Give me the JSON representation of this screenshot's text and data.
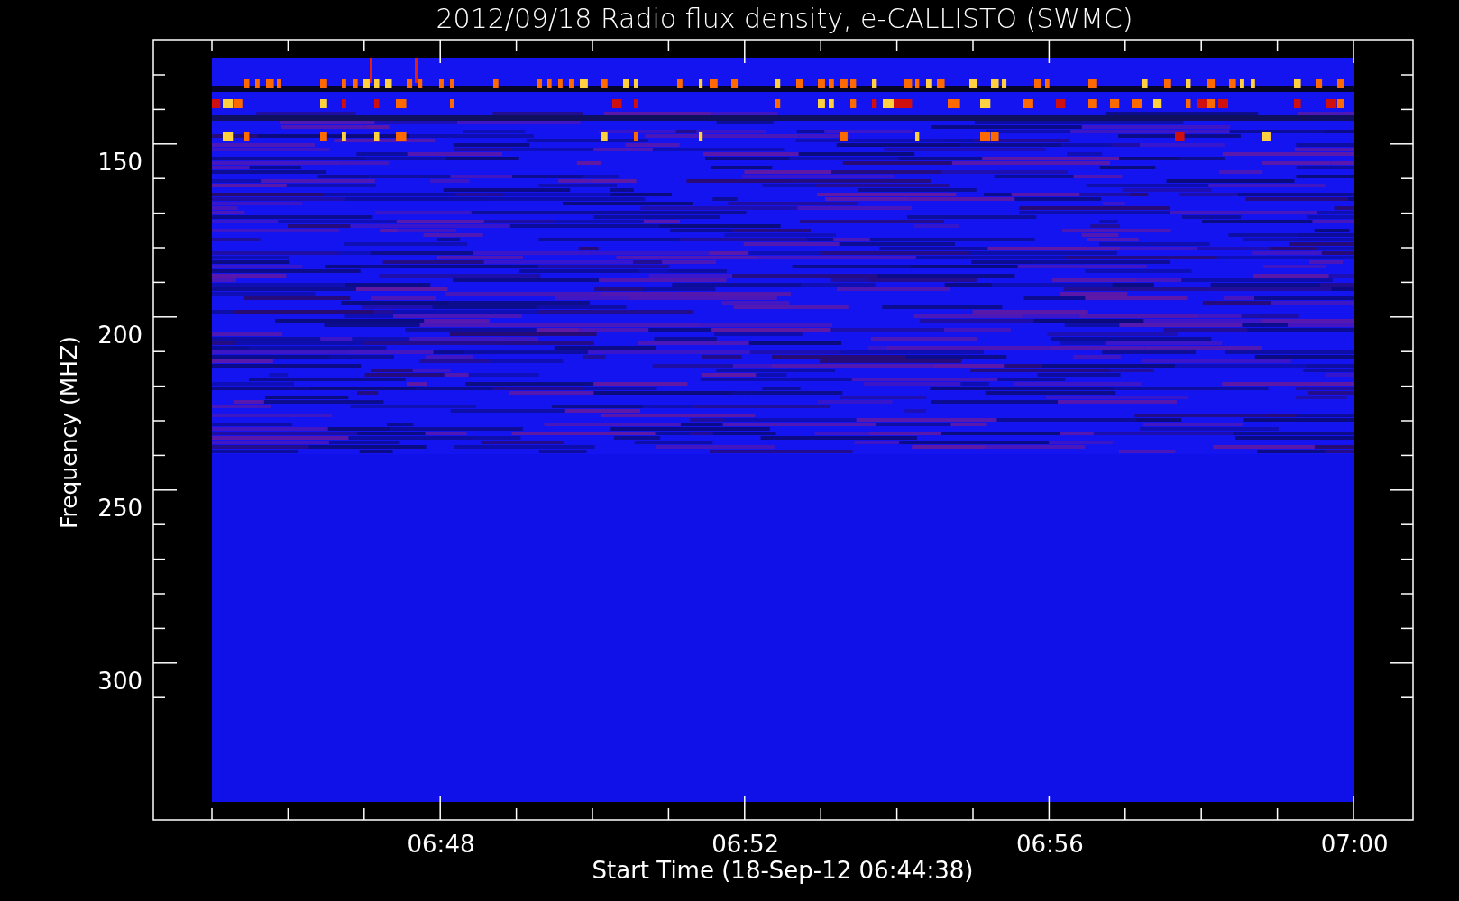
{
  "title": "2012/09/18  Radio flux density, e-CALLISTO (SWMC)",
  "y_axis": {
    "label": "Frequency (MHZ)",
    "ticks": [
      "150",
      "200",
      "250",
      "300"
    ]
  },
  "x_axis": {
    "label": "Start Time (18-Sep-12 06:44:38)",
    "ticks": [
      "06:48",
      "06:52",
      "06:56",
      "07:00"
    ]
  }
}
